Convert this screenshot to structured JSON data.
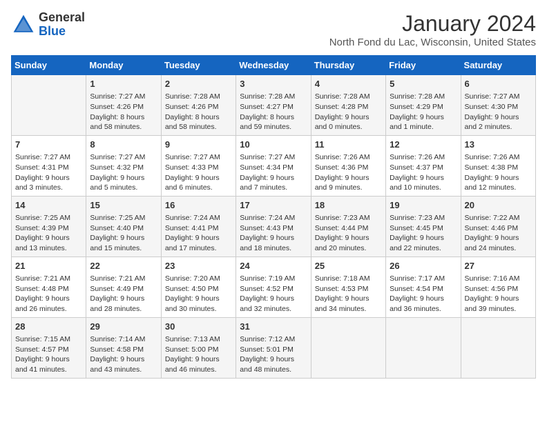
{
  "header": {
    "logo_general": "General",
    "logo_blue": "Blue",
    "month_title": "January 2024",
    "location": "North Fond du Lac, Wisconsin, United States"
  },
  "weekdays": [
    "Sunday",
    "Monday",
    "Tuesday",
    "Wednesday",
    "Thursday",
    "Friday",
    "Saturday"
  ],
  "weeks": [
    [
      {
        "day": "",
        "info": ""
      },
      {
        "day": "1",
        "info": "Sunrise: 7:27 AM\nSunset: 4:26 PM\nDaylight: 8 hours\nand 58 minutes."
      },
      {
        "day": "2",
        "info": "Sunrise: 7:28 AM\nSunset: 4:26 PM\nDaylight: 8 hours\nand 58 minutes."
      },
      {
        "day": "3",
        "info": "Sunrise: 7:28 AM\nSunset: 4:27 PM\nDaylight: 8 hours\nand 59 minutes."
      },
      {
        "day": "4",
        "info": "Sunrise: 7:28 AM\nSunset: 4:28 PM\nDaylight: 9 hours\nand 0 minutes."
      },
      {
        "day": "5",
        "info": "Sunrise: 7:28 AM\nSunset: 4:29 PM\nDaylight: 9 hours\nand 1 minute."
      },
      {
        "day": "6",
        "info": "Sunrise: 7:27 AM\nSunset: 4:30 PM\nDaylight: 9 hours\nand 2 minutes."
      }
    ],
    [
      {
        "day": "7",
        "info": "Sunrise: 7:27 AM\nSunset: 4:31 PM\nDaylight: 9 hours\nand 3 minutes."
      },
      {
        "day": "8",
        "info": "Sunrise: 7:27 AM\nSunset: 4:32 PM\nDaylight: 9 hours\nand 5 minutes."
      },
      {
        "day": "9",
        "info": "Sunrise: 7:27 AM\nSunset: 4:33 PM\nDaylight: 9 hours\nand 6 minutes."
      },
      {
        "day": "10",
        "info": "Sunrise: 7:27 AM\nSunset: 4:34 PM\nDaylight: 9 hours\nand 7 minutes."
      },
      {
        "day": "11",
        "info": "Sunrise: 7:26 AM\nSunset: 4:36 PM\nDaylight: 9 hours\nand 9 minutes."
      },
      {
        "day": "12",
        "info": "Sunrise: 7:26 AM\nSunset: 4:37 PM\nDaylight: 9 hours\nand 10 minutes."
      },
      {
        "day": "13",
        "info": "Sunrise: 7:26 AM\nSunset: 4:38 PM\nDaylight: 9 hours\nand 12 minutes."
      }
    ],
    [
      {
        "day": "14",
        "info": "Sunrise: 7:25 AM\nSunset: 4:39 PM\nDaylight: 9 hours\nand 13 minutes."
      },
      {
        "day": "15",
        "info": "Sunrise: 7:25 AM\nSunset: 4:40 PM\nDaylight: 9 hours\nand 15 minutes."
      },
      {
        "day": "16",
        "info": "Sunrise: 7:24 AM\nSunset: 4:41 PM\nDaylight: 9 hours\nand 17 minutes."
      },
      {
        "day": "17",
        "info": "Sunrise: 7:24 AM\nSunset: 4:43 PM\nDaylight: 9 hours\nand 18 minutes."
      },
      {
        "day": "18",
        "info": "Sunrise: 7:23 AM\nSunset: 4:44 PM\nDaylight: 9 hours\nand 20 minutes."
      },
      {
        "day": "19",
        "info": "Sunrise: 7:23 AM\nSunset: 4:45 PM\nDaylight: 9 hours\nand 22 minutes."
      },
      {
        "day": "20",
        "info": "Sunrise: 7:22 AM\nSunset: 4:46 PM\nDaylight: 9 hours\nand 24 minutes."
      }
    ],
    [
      {
        "day": "21",
        "info": "Sunrise: 7:21 AM\nSunset: 4:48 PM\nDaylight: 9 hours\nand 26 minutes."
      },
      {
        "day": "22",
        "info": "Sunrise: 7:21 AM\nSunset: 4:49 PM\nDaylight: 9 hours\nand 28 minutes."
      },
      {
        "day": "23",
        "info": "Sunrise: 7:20 AM\nSunset: 4:50 PM\nDaylight: 9 hours\nand 30 minutes."
      },
      {
        "day": "24",
        "info": "Sunrise: 7:19 AM\nSunset: 4:52 PM\nDaylight: 9 hours\nand 32 minutes."
      },
      {
        "day": "25",
        "info": "Sunrise: 7:18 AM\nSunset: 4:53 PM\nDaylight: 9 hours\nand 34 minutes."
      },
      {
        "day": "26",
        "info": "Sunrise: 7:17 AM\nSunset: 4:54 PM\nDaylight: 9 hours\nand 36 minutes."
      },
      {
        "day": "27",
        "info": "Sunrise: 7:16 AM\nSunset: 4:56 PM\nDaylight: 9 hours\nand 39 minutes."
      }
    ],
    [
      {
        "day": "28",
        "info": "Sunrise: 7:15 AM\nSunset: 4:57 PM\nDaylight: 9 hours\nand 41 minutes."
      },
      {
        "day": "29",
        "info": "Sunrise: 7:14 AM\nSunset: 4:58 PM\nDaylight: 9 hours\nand 43 minutes."
      },
      {
        "day": "30",
        "info": "Sunrise: 7:13 AM\nSunset: 5:00 PM\nDaylight: 9 hours\nand 46 minutes."
      },
      {
        "day": "31",
        "info": "Sunrise: 7:12 AM\nSunset: 5:01 PM\nDaylight: 9 hours\nand 48 minutes."
      },
      {
        "day": "",
        "info": ""
      },
      {
        "day": "",
        "info": ""
      },
      {
        "day": "",
        "info": ""
      }
    ]
  ]
}
